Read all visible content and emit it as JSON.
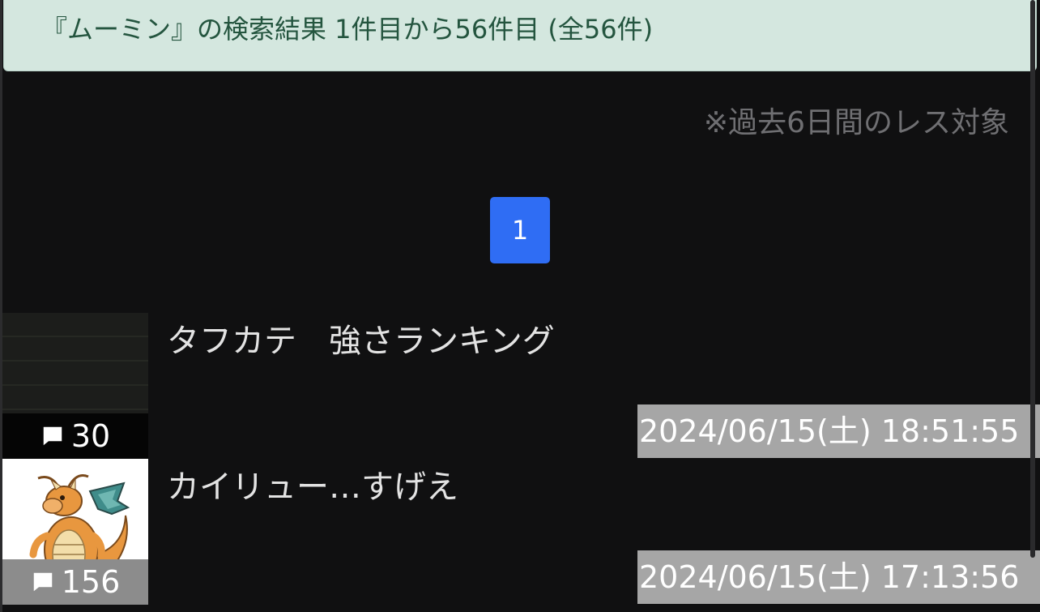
{
  "header": {
    "search_summary": "『ムーミン』の検索結果 1件目から56件目 (全56件)"
  },
  "scope_note": "※過去6日間のレス対象",
  "pagination": {
    "current_page": "1"
  },
  "threads": [
    {
      "title": "タフカテ　強さランキング",
      "reply_count": "30",
      "date": "2024/06/15(土) 18:51:55",
      "thumbnail": "dark-striped-image"
    },
    {
      "title": "カイリュー…すげえ",
      "reply_count": "156",
      "date": "2024/06/15(土) 17:13:56",
      "thumbnail": "dragonite-icon"
    }
  ],
  "colors": {
    "header_bg": "#d4e7df",
    "header_text": "#24553f",
    "page_button": "#2f6df4",
    "background": "#101011"
  }
}
